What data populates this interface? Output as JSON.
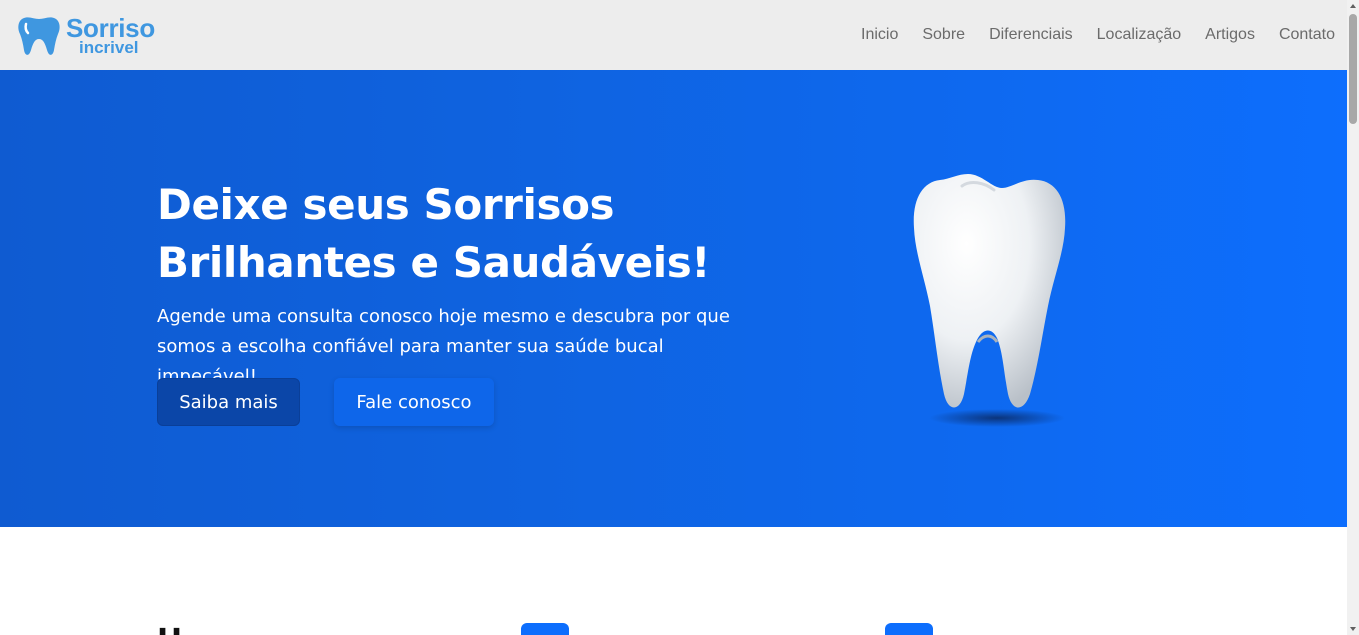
{
  "brand": {
    "title": "Sorriso",
    "subtitle": "incrivel",
    "logo_icon": "tooth-icon",
    "color": "#3f97e0"
  },
  "nav": {
    "items": [
      "Inicio",
      "Sobre",
      "Diferenciais",
      "Localização",
      "Artigos",
      "Contato"
    ]
  },
  "hero": {
    "title_line1": "Deixe seus Sorrisos",
    "title_line2": "Brilhantes e Saudáveis!",
    "subtitle_line1": "Agende uma consulta conosco hoje mesmo e descubra por que",
    "subtitle_line2": "somos a escolha confiável para manter sua saúde bucal impecável!",
    "primary_button": "Saiba mais",
    "secondary_button": "Fale conosco",
    "background_color": "#0d6efd",
    "image_icon": "tooth-illustration"
  },
  "section": {
    "heading_partial": "H"
  }
}
